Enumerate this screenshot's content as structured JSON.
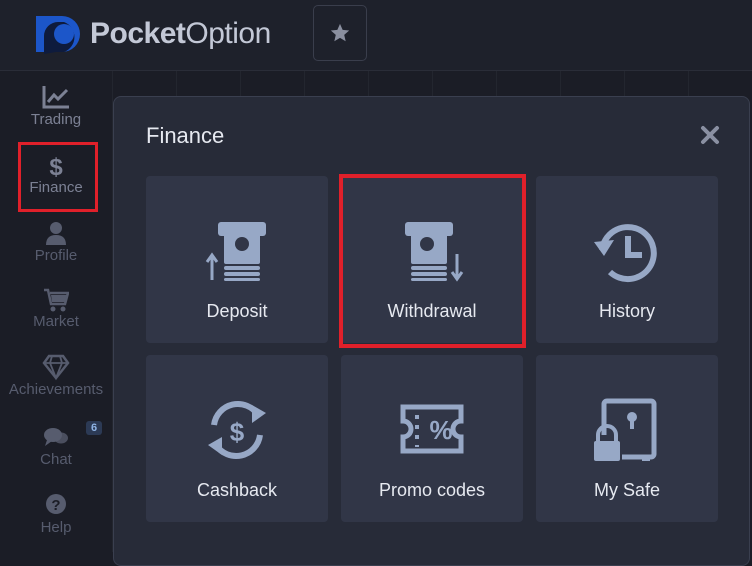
{
  "header": {
    "brand_part1": "Pocket",
    "brand_part2": "Option"
  },
  "sidebar": {
    "items": [
      {
        "label": "Trading"
      },
      {
        "label": "Finance"
      },
      {
        "label": "Profile"
      },
      {
        "label": "Market"
      },
      {
        "label": "Achievements"
      },
      {
        "label": "Chat",
        "badge": "6"
      },
      {
        "label": "Help"
      }
    ]
  },
  "modal": {
    "title": "Finance",
    "tiles": [
      {
        "label": "Deposit",
        "icon": "deposit-icon"
      },
      {
        "label": "Withdrawal",
        "icon": "withdrawal-icon"
      },
      {
        "label": "History",
        "icon": "history-icon"
      },
      {
        "label": "Cashback",
        "icon": "cashback-icon"
      },
      {
        "label": "Promo codes",
        "icon": "promo-codes-icon"
      },
      {
        "label": "My Safe",
        "icon": "safe-icon"
      }
    ]
  },
  "colors": {
    "accent_icon": "#97a8c6",
    "highlight": "#e0202a",
    "modal_bg": "#272b38",
    "tile_bg": "#313647"
  }
}
